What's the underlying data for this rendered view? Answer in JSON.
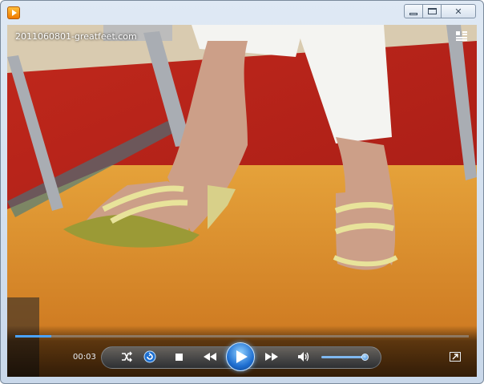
{
  "window": {
    "app_icon": "windows-media-player-icon",
    "minimize_icon": "minimize-icon",
    "maximize_icon": "restore-icon",
    "close_glyph": "✕"
  },
  "video": {
    "title": "2011060801-greatfeet.com",
    "view_icon": "switch-to-library-icon"
  },
  "controls": {
    "current_time": "00:03",
    "seek_progress": 0.08,
    "volume_level": 0.95,
    "shuffle_icon": "shuffle-icon",
    "repeat_icon": "repeat-icon",
    "stop_icon": "stop-icon",
    "previous_icon": "previous-icon",
    "play_icon": "play-icon",
    "next_icon": "next-icon",
    "mute_icon": "speaker-icon",
    "fullscreen_icon": "fullscreen-icon",
    "accent_color": "#4aa3ff"
  }
}
